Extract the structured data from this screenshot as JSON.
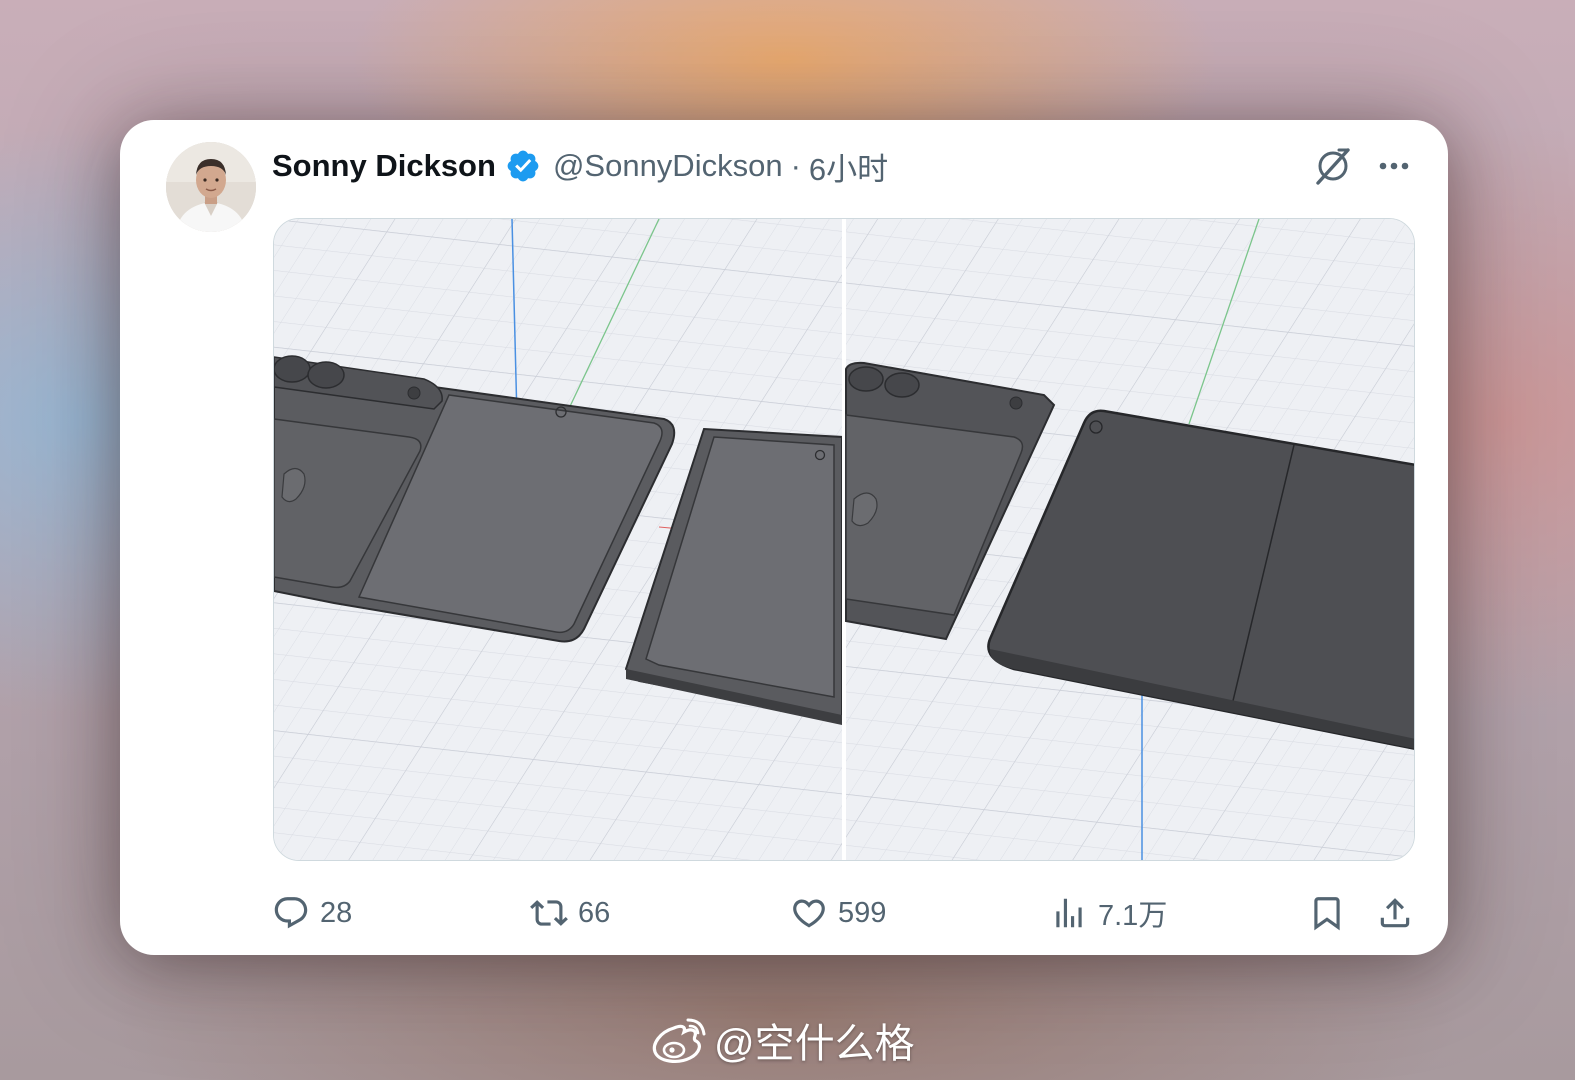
{
  "tweet": {
    "author_name": "Sonny Dickson",
    "handle": "@SonnyDickson",
    "separator": "·",
    "time": "6小时",
    "verified": true
  },
  "header_icons": {
    "grok": "grok-icon",
    "more": "more-icon"
  },
  "media": {
    "images": [
      {
        "description_icon": "foldable-iphone-render-left"
      },
      {
        "description_icon": "foldable-iphone-render-right"
      }
    ]
  },
  "actions": {
    "reply": {
      "icon": "reply-icon",
      "count": "28"
    },
    "retweet": {
      "icon": "retweet-icon",
      "count": "66"
    },
    "like": {
      "icon": "heart-icon",
      "count": "599"
    },
    "views": {
      "icon": "views-icon",
      "count": "7.1万"
    },
    "bookmark": {
      "icon": "bookmark-icon"
    },
    "share": {
      "icon": "share-icon"
    }
  },
  "watermark": {
    "text": "@空什么格",
    "icon": "weibo-icon"
  },
  "colors": {
    "verified": "#1d9bf0",
    "text_primary": "#0f1419",
    "text_secondary": "#536471",
    "card_bg": "#ffffff"
  }
}
